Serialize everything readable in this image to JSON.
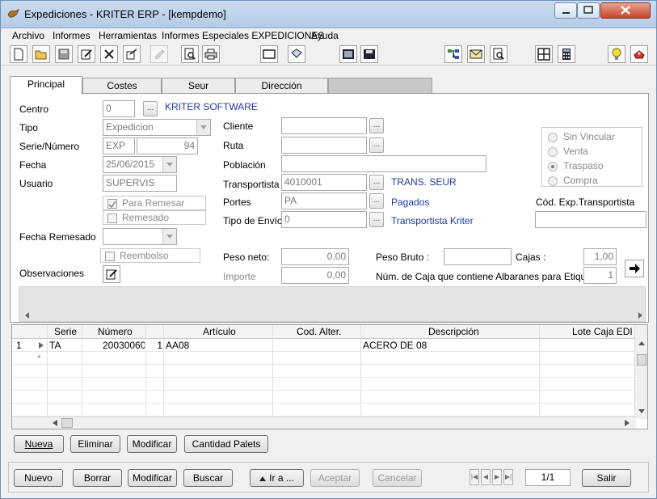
{
  "window": {
    "title": "Expediciones - KRITER ERP - [kempdemo]"
  },
  "menu": [
    "Archivo",
    "Informes",
    "Herramientas",
    "Informes Especiales EXPEDICIONES",
    "Ayuda"
  ],
  "tabs": [
    "Principal",
    "Costes",
    "Seur",
    "Dirección"
  ],
  "form": {
    "centro": {
      "label": "Centro",
      "value": "0",
      "name": "KRITER SOFTWARE"
    },
    "tipo": {
      "label": "Tipo",
      "value": "Expedicion"
    },
    "serie_numero": {
      "label": "Serie/Número",
      "serie": "EXP",
      "numero": "94"
    },
    "fecha": {
      "label": "Fecha",
      "value": "25/06/2015"
    },
    "usuario": {
      "label": "Usuario",
      "value": "SUPERVIS"
    },
    "para_remesar": {
      "label": "Para Remesar",
      "checked": true
    },
    "remesado": {
      "label": "Remesado",
      "checked": false
    },
    "fecha_remesado": {
      "label": "Fecha Remesado",
      "value": ""
    },
    "reembolso": {
      "label": "Reembolso",
      "checked": false
    },
    "observaciones": {
      "label": "Observaciones"
    },
    "cliente": {
      "label": "Cliente",
      "value": ""
    },
    "ruta": {
      "label": "Ruta",
      "value": ""
    },
    "poblacion": {
      "label": "Población",
      "value": ""
    },
    "transportista": {
      "label": "Transportista",
      "value": "4010001",
      "name": "TRANS. SEUR"
    },
    "portes": {
      "label": "Portes",
      "value": "PA",
      "name": "Pagados"
    },
    "tipo_envio": {
      "label": "Tipo de Envío",
      "value": "0",
      "name": "Transportista Kriter"
    },
    "vinculacion": {
      "options": [
        "Sin Vincular",
        "Venta",
        "Traspaso",
        "Compra"
      ],
      "selected": "Traspaso"
    },
    "cod_exp_transportista": {
      "label": "Cód. Exp.Transportista",
      "value": ""
    },
    "peso_neto": {
      "label": "Peso neto:",
      "value": "0,00"
    },
    "importe": {
      "label": "Importe",
      "value": "0,00"
    },
    "peso_bruto": {
      "label": "Peso Bruto :",
      "value": ""
    },
    "cajas": {
      "label": "Cajas :",
      "value": "1,00"
    },
    "num_caja": {
      "label": "Núm. de Caja que contiene Albaranes para Etiquetas",
      "value": "1"
    }
  },
  "grid": {
    "columns": [
      "Serie",
      "Número",
      "Artículo",
      "Cod. Alter.",
      "Descripción",
      "Lote Caja EDI"
    ],
    "rows": [
      {
        "row_num": "1",
        "serie": "TA",
        "numero": "20030060",
        "articulo_linea": "1",
        "articulo": "AA08",
        "cod_alter": "",
        "descripcion": "ACERO DE 08",
        "lote": ""
      }
    ],
    "new_row_marker": "*"
  },
  "grid_buttons": [
    "Nueva",
    "Eliminar",
    "Modificar",
    "Cantidad Palets"
  ],
  "footer_buttons": {
    "nuevo": "Nuevo",
    "borrar": "Borrar",
    "modificar": "Modificar",
    "buscar": "Buscar",
    "ir_a": "Ir a ...",
    "aceptar": "Aceptar",
    "cancelar": "Cancelar",
    "salir": "Salir"
  },
  "record_position": "1/1",
  "toolbar_icons": [
    "new-doc-icon",
    "open-folder-icon",
    "save-icon",
    "edit-icon",
    "delete-icon",
    "copy-icon",
    "disabled-icon",
    "print-preview-icon",
    "print-icon",
    "window-icon",
    "paste-icon",
    "calculator-grid-icon",
    "save-disk-icon",
    "tree-icon",
    "mail-icon",
    "search-doc-icon",
    "grid-icon",
    "calculator-icon",
    "lightbulb-icon",
    "help-icon"
  ],
  "colors": {
    "link_blue": "#1f3aa0",
    "title_bar": "#b4cbe9",
    "close_red": "#c7442c"
  }
}
